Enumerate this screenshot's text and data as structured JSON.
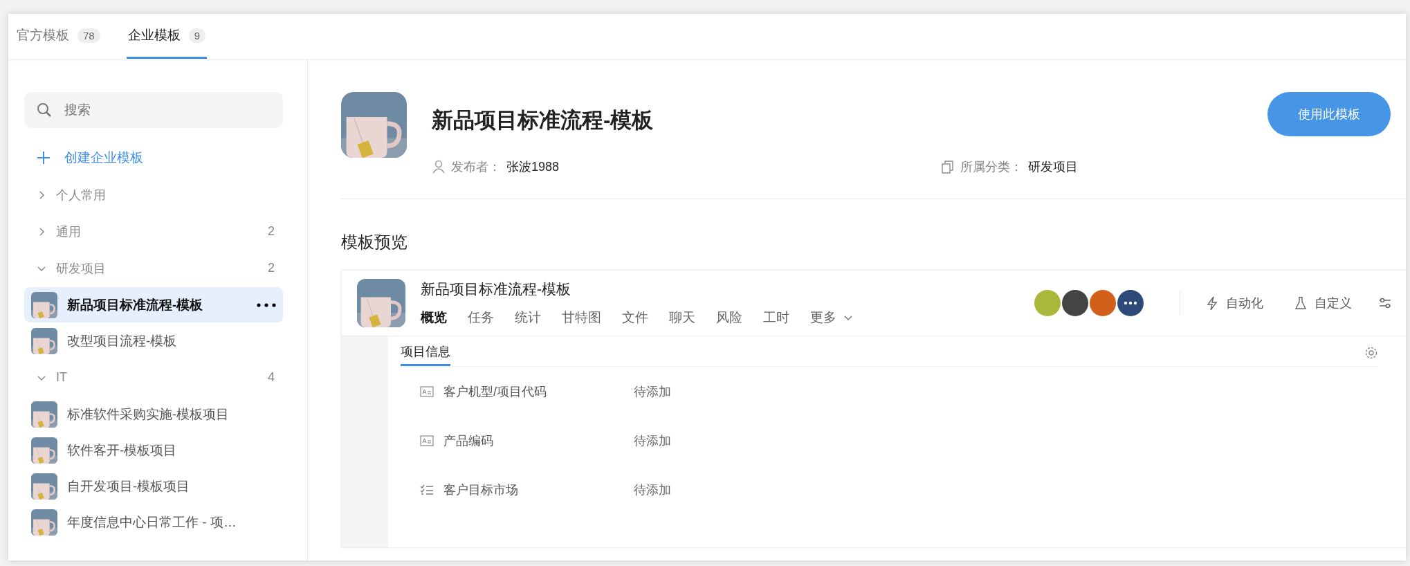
{
  "tabs": [
    {
      "label": "官方模板",
      "count": "78",
      "selected": false
    },
    {
      "label": "企业模板",
      "count": "9",
      "selected": true
    }
  ],
  "sidebar": {
    "search": {
      "placeholder": "搜索"
    },
    "create_label": "创建企业模板",
    "groups": [
      {
        "label": "个人常用",
        "expanded": false
      },
      {
        "label": "通用",
        "count": "2",
        "expanded": false
      },
      {
        "label": "研发项目",
        "count": "2",
        "expanded": true,
        "children": [
          {
            "label": "新品项目标准流程-模板",
            "selected": true
          },
          {
            "label": "改型项目流程-模板",
            "selected": false
          }
        ]
      },
      {
        "label": "IT",
        "count": "4",
        "expanded": true,
        "children": [
          {
            "label": "标准软件采购实施-模板项目",
            "selected": false
          },
          {
            "label": "软件客开-模板项目",
            "selected": false
          },
          {
            "label": "自开发项目-模板项目",
            "selected": false
          },
          {
            "label": "年度信息中心日常工作 - 项…",
            "selected": false
          }
        ]
      }
    ]
  },
  "detail": {
    "title": "新品项目标准流程-模板",
    "button": "使用此模板",
    "publisher_label": "发布者：",
    "publisher": "张波1988",
    "category_label": "所属分类：",
    "category": "研发项目"
  },
  "preview": {
    "heading": "模板预览",
    "project_title": "新品项目标准流程-模板",
    "nav": [
      {
        "label": "概览",
        "selected": true
      },
      {
        "label": "任务",
        "selected": false
      },
      {
        "label": "统计",
        "selected": false
      },
      {
        "label": "甘特图",
        "selected": false
      },
      {
        "label": "文件",
        "selected": false
      },
      {
        "label": "聊天",
        "selected": false
      },
      {
        "label": "风险",
        "selected": false
      },
      {
        "label": "工时",
        "selected": false
      }
    ],
    "nav_more": "更多",
    "actions": [
      {
        "kind": "bolt",
        "label": "自动化"
      },
      {
        "kind": "flask",
        "label": "自定义"
      },
      {
        "kind": "sliders"
      }
    ],
    "content_tabs": [
      {
        "label": "项目信息",
        "selected": true
      }
    ],
    "rows": [
      {
        "kind": "text",
        "label": "客户机型/项目代码",
        "value": "待添加"
      },
      {
        "kind": "text",
        "label": "产品编码",
        "value": "待添加"
      },
      {
        "kind": "list",
        "label": "客户目标市场",
        "value": "待添加"
      }
    ]
  }
}
